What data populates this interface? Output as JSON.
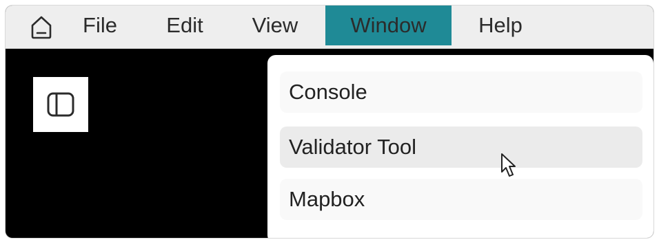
{
  "menubar": {
    "home_icon": "home-icon",
    "items": [
      {
        "label": "File"
      },
      {
        "label": "Edit"
      },
      {
        "label": "View"
      },
      {
        "label": "Window",
        "active": true
      },
      {
        "label": "Help"
      }
    ]
  },
  "workspace": {
    "toggle_icon": "sidebar-toggle-icon"
  },
  "window_menu": {
    "items": [
      {
        "label": "Console"
      },
      {
        "label": "Validator Tool",
        "hovered": true
      },
      {
        "label": "Mapbox"
      }
    ]
  },
  "colors": {
    "active_menu": "#1f8a96",
    "menubar_bg": "#eeeeee",
    "workspace_bg": "#000000"
  }
}
